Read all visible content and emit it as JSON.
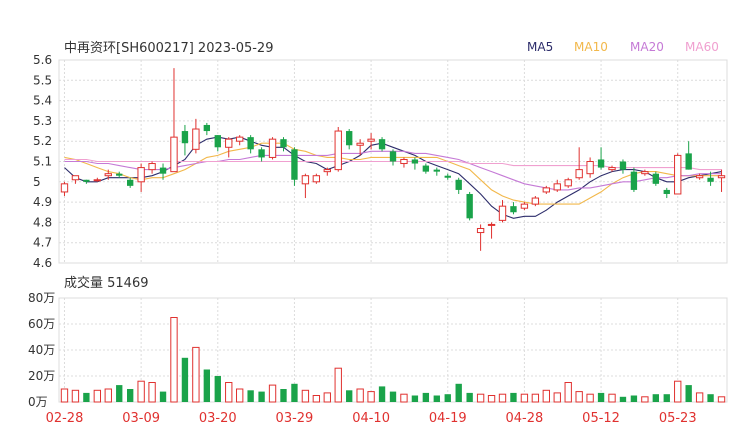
{
  "chart_data": [
    {
      "type": "candlestick",
      "title": "中再资环[SH600217] 2023-05-29",
      "legend": [
        {
          "name": "MA5",
          "color": "#2d2d6b"
        },
        {
          "name": "MA10",
          "color": "#f2b84b"
        },
        {
          "name": "MA20",
          "color": "#c57ad6"
        },
        {
          "name": "MA60",
          "color": "#f0a0d0"
        }
      ],
      "ylim": [
        4.6,
        5.6
      ],
      "yticks": [
        "5.6",
        "5.5",
        "5.4",
        "5.3",
        "5.2",
        "5.1",
        "5",
        "4.9",
        "4.8",
        "4.7",
        "4.6"
      ],
      "up_color": "#e0312f",
      "down_color": "#1aa34a",
      "candles": [
        [
          4.95,
          4.99,
          4.93,
          5.0
        ],
        [
          5.01,
          5.03,
          4.99,
          5.03
        ],
        [
          5.01,
          5.0,
          4.99,
          5.01
        ],
        [
          5.01,
          5.01,
          5.0,
          5.02
        ],
        [
          5.03,
          5.04,
          5.01,
          5.06
        ],
        [
          5.04,
          5.03,
          5.02,
          5.05
        ],
        [
          5.01,
          4.98,
          4.97,
          5.02
        ],
        [
          5.0,
          5.07,
          4.95,
          5.09
        ],
        [
          5.06,
          5.09,
          5.04,
          5.1
        ],
        [
          5.07,
          5.04,
          5.01,
          5.09
        ],
        [
          5.05,
          5.22,
          5.05,
          5.56
        ],
        [
          5.25,
          5.19,
          5.13,
          5.28
        ],
        [
          5.16,
          5.26,
          5.14,
          5.31
        ],
        [
          5.28,
          5.25,
          5.23,
          5.29
        ],
        [
          5.23,
          5.17,
          5.15,
          5.23
        ],
        [
          5.17,
          5.21,
          5.12,
          5.22
        ],
        [
          5.2,
          5.22,
          5.18,
          5.23
        ],
        [
          5.22,
          5.16,
          5.14,
          5.23
        ],
        [
          5.16,
          5.12,
          5.1,
          5.17
        ],
        [
          5.12,
          5.21,
          5.11,
          5.22
        ],
        [
          5.21,
          5.17,
          5.15,
          5.22
        ],
        [
          5.16,
          5.01,
          4.98,
          5.17
        ],
        [
          4.99,
          5.03,
          4.92,
          5.04
        ],
        [
          5.0,
          5.03,
          4.99,
          5.04
        ],
        [
          5.05,
          5.06,
          5.03,
          5.07
        ],
        [
          5.06,
          5.25,
          5.05,
          5.27
        ],
        [
          5.25,
          5.18,
          5.16,
          5.26
        ],
        [
          5.18,
          5.19,
          5.13,
          5.21
        ],
        [
          5.2,
          5.21,
          5.16,
          5.24
        ],
        [
          5.21,
          5.16,
          5.15,
          5.22
        ],
        [
          5.15,
          5.1,
          5.08,
          5.16
        ],
        [
          5.09,
          5.11,
          5.07,
          5.12
        ],
        [
          5.11,
          5.09,
          5.06,
          5.12
        ],
        [
          5.08,
          5.05,
          5.04,
          5.09
        ],
        [
          5.06,
          5.05,
          5.03,
          5.07
        ],
        [
          5.03,
          5.02,
          5.01,
          5.04
        ],
        [
          5.01,
          4.96,
          4.94,
          5.02
        ],
        [
          4.94,
          4.82,
          4.81,
          4.95
        ],
        [
          4.75,
          4.77,
          4.66,
          4.79
        ],
        [
          4.79,
          4.79,
          4.72,
          4.8
        ],
        [
          4.81,
          4.88,
          4.8,
          4.91
        ],
        [
          4.88,
          4.85,
          4.84,
          4.9
        ],
        [
          4.87,
          4.89,
          4.86,
          4.9
        ],
        [
          4.89,
          4.92,
          4.88,
          4.93
        ],
        [
          4.95,
          4.97,
          4.94,
          4.98
        ],
        [
          4.96,
          4.99,
          4.95,
          5.01
        ],
        [
          4.98,
          5.01,
          4.97,
          5.02
        ],
        [
          5.02,
          5.06,
          5.01,
          5.17
        ],
        [
          5.04,
          5.1,
          5.02,
          5.12
        ],
        [
          5.11,
          5.07,
          5.06,
          5.17
        ],
        [
          5.06,
          5.07,
          5.05,
          5.08
        ],
        [
          5.1,
          5.06,
          5.04,
          5.11
        ],
        [
          5.05,
          4.96,
          4.95,
          5.07
        ],
        [
          5.04,
          5.05,
          5.03,
          5.06
        ],
        [
          5.04,
          4.99,
          4.98,
          5.05
        ],
        [
          4.96,
          4.94,
          4.92,
          4.97
        ],
        [
          4.94,
          5.13,
          4.94,
          5.14
        ],
        [
          5.14,
          5.06,
          5.06,
          5.2
        ],
        [
          5.02,
          5.03,
          5.01,
          5.04
        ],
        [
          5.02,
          5.0,
          4.98,
          5.05
        ],
        [
          5.02,
          5.03,
          4.95,
          5.06
        ]
      ],
      "ma5": [
        5.07,
        5.02,
        5.0,
        5.0,
        5.02,
        5.02,
        5.02,
        5.02,
        5.03,
        5.05,
        5.08,
        5.11,
        5.18,
        5.21,
        5.22,
        5.21,
        5.22,
        5.2,
        5.18,
        5.17,
        5.17,
        5.13,
        5.1,
        5.09,
        5.06,
        5.08,
        5.1,
        5.13,
        5.18,
        5.19,
        5.17,
        5.15,
        5.13,
        5.1,
        5.08,
        5.06,
        5.04,
        4.99,
        4.94,
        4.88,
        4.84,
        4.82,
        4.83,
        4.83,
        4.86,
        4.9,
        4.93,
        4.96,
        5.0,
        5.03,
        5.05,
        5.06,
        5.06,
        5.05,
        5.02,
        5.0,
        5.0,
        5.02,
        5.03,
        5.04,
        5.05
      ],
      "ma10": [
        5.12,
        5.11,
        5.09,
        5.07,
        5.05,
        5.04,
        5.02,
        5.01,
        5.02,
        5.02,
        5.04,
        5.06,
        5.09,
        5.12,
        5.13,
        5.15,
        5.16,
        5.17,
        5.19,
        5.19,
        5.19,
        5.16,
        5.15,
        5.13,
        5.12,
        5.12,
        5.11,
        5.11,
        5.12,
        5.12,
        5.12,
        5.12,
        5.12,
        5.12,
        5.12,
        5.1,
        5.08,
        5.06,
        5.01,
        4.96,
        4.93,
        4.91,
        4.9,
        4.89,
        4.89,
        4.89,
        4.89,
        4.89,
        4.92,
        4.95,
        4.99,
        5.02,
        5.04,
        5.05,
        5.05,
        5.04,
        5.03,
        5.03,
        5.03,
        5.03,
        5.03
      ],
      "ma20": [
        5.1,
        5.1,
        5.1,
        5.09,
        5.09,
        5.08,
        5.07,
        5.06,
        5.06,
        5.06,
        5.07,
        5.08,
        5.09,
        5.1,
        5.1,
        5.11,
        5.11,
        5.12,
        5.13,
        5.13,
        5.13,
        5.13,
        5.13,
        5.13,
        5.13,
        5.14,
        5.14,
        5.14,
        5.15,
        5.15,
        5.15,
        5.15,
        5.14,
        5.14,
        5.13,
        5.12,
        5.11,
        5.09,
        5.07,
        5.05,
        5.03,
        5.01,
        4.99,
        4.98,
        4.97,
        4.96,
        4.96,
        4.97,
        4.97,
        4.98,
        4.99,
        5.0,
        5.0,
        5.01,
        5.02,
        5.02,
        5.03,
        5.03,
        5.04,
        5.04,
        5.04
      ],
      "ma60": [
        5.11,
        5.11,
        5.11,
        5.1,
        5.1,
        5.1,
        5.1,
        5.1,
        5.1,
        5.1,
        5.1,
        5.1,
        5.1,
        5.1,
        5.1,
        5.1,
        5.1,
        5.1,
        5.1,
        5.1,
        5.1,
        5.1,
        5.1,
        5.1,
        5.1,
        5.1,
        5.1,
        5.1,
        5.1,
        5.1,
        5.1,
        5.1,
        5.1,
        5.1,
        5.1,
        5.1,
        5.1,
        5.09,
        5.09,
        5.09,
        5.09,
        5.08,
        5.08,
        5.08,
        5.08,
        5.08,
        5.08,
        5.08,
        5.08,
        5.08,
        5.07,
        5.07,
        5.07,
        5.07,
        5.07,
        5.07,
        5.07,
        5.07,
        5.06,
        5.06,
        5.06
      ]
    },
    {
      "type": "bar",
      "title": "成交量 51469",
      "ylim": [
        0,
        80
      ],
      "yticks": [
        "80万",
        "60万",
        "40万",
        "20万",
        "0万"
      ],
      "values": [
        10,
        9,
        7,
        9,
        10,
        13,
        10,
        16,
        15,
        8,
        65,
        34,
        42,
        25,
        20,
        15,
        10,
        9,
        8,
        13,
        10,
        14,
        9,
        5,
        7,
        26,
        9,
        10,
        8,
        12,
        8,
        6,
        5,
        7,
        5,
        6,
        14,
        7,
        6,
        5,
        6,
        7,
        6,
        6,
        9,
        7,
        15,
        8,
        6,
        7,
        6,
        4,
        5,
        4,
        6,
        6,
        16,
        13,
        7,
        6,
        4
      ],
      "dates": [
        "02-28",
        "03-09",
        "03-20",
        "03-29",
        "04-10",
        "04-19",
        "04-28",
        "05-12",
        "05-23"
      ],
      "date_index": [
        0,
        7,
        14,
        21,
        28,
        35,
        42,
        49,
        56
      ]
    }
  ]
}
